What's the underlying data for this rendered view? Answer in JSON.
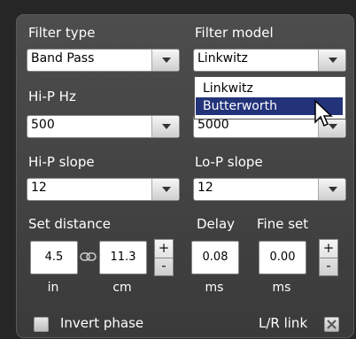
{
  "filter_type": {
    "label": "Filter type",
    "value": "Band Pass"
  },
  "filter_model": {
    "label": "Filter model",
    "value": "Linkwitz",
    "options": [
      "Linkwitz",
      "Butterworth"
    ],
    "highlighted": "Butterworth"
  },
  "hi_p_hz": {
    "label": "Hi-P Hz",
    "value": "500"
  },
  "lo_p_hz": {
    "value_partial": "5000"
  },
  "hi_p_slope": {
    "label": "Hi-P slope",
    "value": "12"
  },
  "lo_p_slope": {
    "label": "Lo-P slope",
    "value": "12"
  },
  "set_distance": {
    "label": "Set distance",
    "in_value": "4.5",
    "cm_value": "11.3",
    "unit_in": "in",
    "unit_cm": "cm",
    "link_icon": "link-icon"
  },
  "delay": {
    "label": "Delay",
    "value": "0.08",
    "unit": "ms"
  },
  "fine_set": {
    "label": "Fine set",
    "value": "0.00",
    "unit": "ms"
  },
  "spinner": {
    "plus": "+",
    "minus": "-"
  },
  "invert_phase": {
    "label": "Invert phase",
    "checked": false
  },
  "lr_link": {
    "label": "L/R link",
    "checked": true
  },
  "colors": {
    "panel": "#444444",
    "highlight": "#23337a",
    "text": "#ffffff"
  }
}
